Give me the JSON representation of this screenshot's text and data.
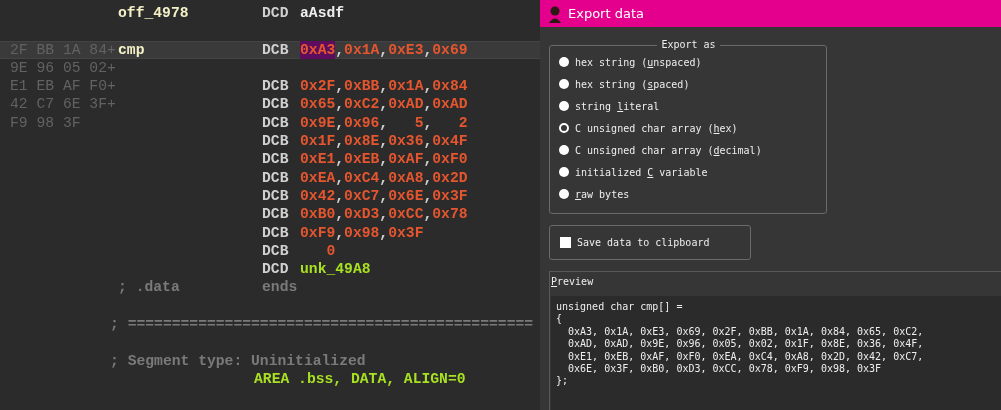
{
  "disassembly": {
    "lines": [
      {
        "kind": "name",
        "current": false,
        "label": "off_4978",
        "mnemonic": "DCD",
        "operands": "aAsdf"
      },
      {
        "kind": "blank"
      },
      {
        "kind": "number",
        "current": true,
        "bytes": "2F BB 1A 84+",
        "label": "cmp",
        "mnemonic": "DCB",
        "selected_operand": "0xA3",
        "operands": ",0x1A,0xE3,0x69"
      },
      {
        "kind": "number",
        "current": false,
        "bytes": "9E 96 05 02+"
      },
      {
        "kind": "number",
        "current": false,
        "bytes": "E1 EB AF F0+",
        "mnemonic": "DCB",
        "operands": "0x2F,0xBB,0x1A,0x84"
      },
      {
        "kind": "number",
        "current": false,
        "bytes": "42 C7 6E 3F+",
        "mnemonic": "DCB",
        "operands": "0x65,0xC2,0xAD,0xAD"
      },
      {
        "kind": "number",
        "current": false,
        "bytes": "F9 98 3F",
        "mnemonic": "DCB",
        "operands": "0x9E,0x96,   5,   2"
      },
      {
        "kind": "number",
        "current": false,
        "mnemonic": "DCB",
        "operands": "0x1F,0x8E,0x36,0x4F"
      },
      {
        "kind": "number",
        "current": false,
        "mnemonic": "DCB",
        "operands": "0xE1,0xEB,0xAF,0xF0"
      },
      {
        "kind": "number",
        "current": false,
        "mnemonic": "DCB",
        "operands": "0xEA,0xC4,0xA8,0x2D"
      },
      {
        "kind": "number",
        "current": false,
        "mnemonic": "DCB",
        "operands": "0x42,0xC7,0x6E,0x3F"
      },
      {
        "kind": "number",
        "current": false,
        "mnemonic": "DCB",
        "operands": "0xB0,0xD3,0xCC,0x78"
      },
      {
        "kind": "number",
        "current": false,
        "mnemonic": "DCB",
        "operands": "0xF9,0x98,0x3F"
      },
      {
        "kind": "number",
        "current": false,
        "mnemonic": "DCB",
        "operands": "   0"
      },
      {
        "kind": "ref",
        "current": false,
        "mnemonic": "DCD",
        "operands": "unk_49A8"
      },
      {
        "kind": "ends",
        "label": "; .data",
        "mnemonic": "ends"
      },
      {
        "kind": "blank"
      },
      {
        "kind": "comment",
        "text": "; =============================================="
      },
      {
        "kind": "blank"
      },
      {
        "kind": "comment",
        "text": "; Segment type: Uninitialized"
      },
      {
        "kind": "directive",
        "text": "AREA .bss, DATA, ALIGN=0"
      }
    ]
  },
  "dialog": {
    "title": "Export data",
    "export_group": {
      "title": "Export as",
      "options": [
        {
          "pre": "hex string (",
          "key": "u",
          "post": "nspaced)",
          "selected": false
        },
        {
          "pre": "hex string (",
          "key": "s",
          "post": "paced)",
          "selected": false
        },
        {
          "pre": "string ",
          "key": "l",
          "post": "iteral",
          "selected": false
        },
        {
          "pre": "C unsigned char array (",
          "key": "h",
          "post": "ex)",
          "selected": true
        },
        {
          "pre": "C unsigned char array (",
          "key": "d",
          "post": "ecimal)",
          "selected": false
        },
        {
          "pre": "initialized ",
          "key": "C",
          "post": " variable",
          "selected": false
        },
        {
          "key": "r",
          "post": "aw bytes",
          "selected": false
        }
      ]
    },
    "clipboard": {
      "label": "Save data to clipboard",
      "checked": false
    },
    "preview": {
      "key": "P",
      "post": "review",
      "lines": [
        "unsigned char cmp[] =",
        "{",
        "  0xA3, 0x1A, 0xE3, 0x69, 0x2F, 0xBB, 0x1A, 0x84, 0x65, 0xC2,",
        "  0xAD, 0xAD, 0x9E, 0x96, 0x05, 0x02, 0x1F, 0x8E, 0x36, 0x4F,",
        "  0xE1, 0xEB, 0xAF, 0xF0, 0xEA, 0xC4, 0xA8, 0x2D, 0x42, 0xC7,",
        "  0x6E, 0x3F, 0xB0, 0xD3, 0xCC, 0x78, 0xF9, 0x98, 0x3F",
        "};"
      ]
    }
  }
}
